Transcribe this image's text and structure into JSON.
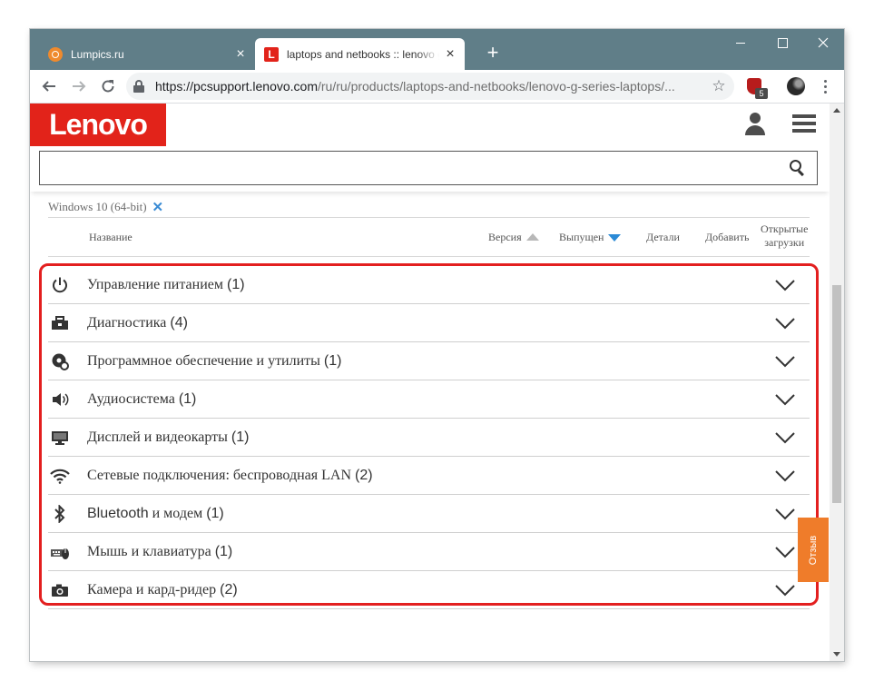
{
  "browser": {
    "tabs": [
      {
        "title": "Lumpics.ru",
        "favicon": "lumpics-favicon",
        "active": false,
        "close": "×"
      },
      {
        "title": "laptops and netbooks :: lenovo g series laptops",
        "favicon": "lenovo-favicon",
        "favicon_letter": "L",
        "active": true
      }
    ],
    "new_tab": "+",
    "url_host": "https://pcsupport.lenovo.com",
    "url_path": "/ru/ru/products/laptops-and-netbooks/lenovo-g-series-laptops/...",
    "bookmark_icon": "star-icon",
    "extension_badge": "5"
  },
  "page": {
    "logo": "Lenovo",
    "search": {
      "value": "",
      "placeholder": ""
    },
    "filter": {
      "os": "Windows 10 (64-bit)",
      "remove": "✕"
    },
    "columns": {
      "name": "Название",
      "version": "Версия",
      "released": "Выпущен",
      "details": "Детали",
      "add": "Добавить",
      "open_downloads_line1": "Открытые",
      "open_downloads_line2": "загрузки"
    },
    "categories": [
      {
        "label": "Управление питанием",
        "count": "(1)",
        "icon": "power-icon"
      },
      {
        "label": "Диагностика",
        "count": "(4)",
        "icon": "toolbox-icon"
      },
      {
        "label": "Программное обеспечение и утилиты",
        "count": "(1)",
        "icon": "software-disc-icon"
      },
      {
        "label": "Аудиосистема",
        "count": "(1)",
        "icon": "speaker-icon"
      },
      {
        "label": "Дисплей и видеокарты",
        "count": "(1)",
        "icon": "monitor-icon"
      },
      {
        "label": "Сетевые подключения: беспроводная LAN",
        "count": "(2)",
        "icon": "wifi-icon"
      },
      {
        "label": "Bluetooth",
        "label_rest": " и модем",
        "count": "(1)",
        "icon": "bluetooth-icon"
      },
      {
        "label": "Мышь и клавиатура",
        "count": "(1)",
        "icon": "mouse-keyboard-icon"
      },
      {
        "label": "Камера и кард-ридер",
        "count": "(2)",
        "icon": "camera-icon"
      }
    ],
    "feedback": "Отзыв"
  },
  "colors": {
    "brand": "#e2231a",
    "highlight": "#e31f1f",
    "accent": "#2b8ad6",
    "feedback": "#ef7c2a",
    "tabstrip": "#607e88"
  }
}
